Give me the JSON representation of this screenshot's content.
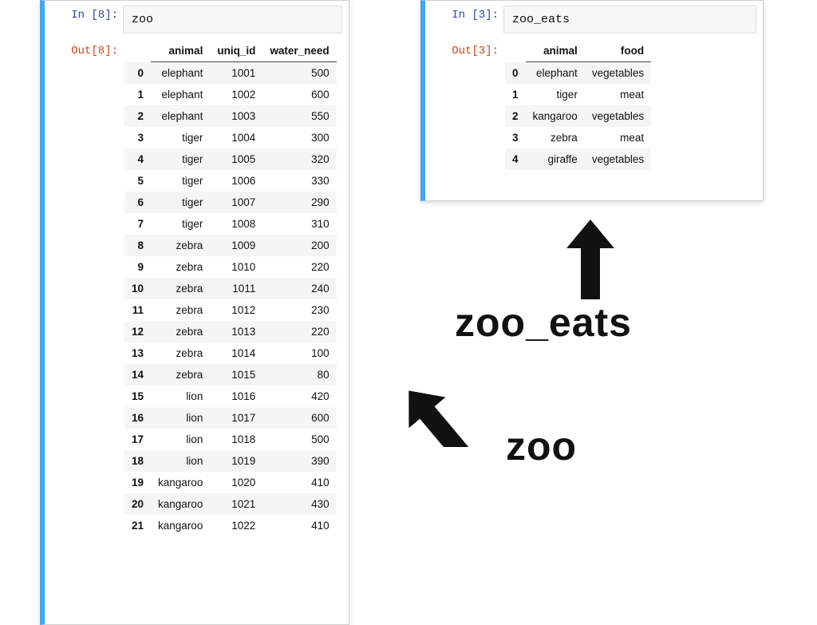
{
  "cells": {
    "left": {
      "in_prompt": "In [8]:",
      "out_prompt": "Out[8]:",
      "code": "zoo",
      "columns": [
        "animal",
        "uniq_id",
        "water_need"
      ],
      "rows": [
        {
          "idx": "0",
          "animal": "elephant",
          "uniq_id": "1001",
          "water_need": "500"
        },
        {
          "idx": "1",
          "animal": "elephant",
          "uniq_id": "1002",
          "water_need": "600"
        },
        {
          "idx": "2",
          "animal": "elephant",
          "uniq_id": "1003",
          "water_need": "550"
        },
        {
          "idx": "3",
          "animal": "tiger",
          "uniq_id": "1004",
          "water_need": "300"
        },
        {
          "idx": "4",
          "animal": "tiger",
          "uniq_id": "1005",
          "water_need": "320"
        },
        {
          "idx": "5",
          "animal": "tiger",
          "uniq_id": "1006",
          "water_need": "330"
        },
        {
          "idx": "6",
          "animal": "tiger",
          "uniq_id": "1007",
          "water_need": "290"
        },
        {
          "idx": "7",
          "animal": "tiger",
          "uniq_id": "1008",
          "water_need": "310"
        },
        {
          "idx": "8",
          "animal": "zebra",
          "uniq_id": "1009",
          "water_need": "200"
        },
        {
          "idx": "9",
          "animal": "zebra",
          "uniq_id": "1010",
          "water_need": "220"
        },
        {
          "idx": "10",
          "animal": "zebra",
          "uniq_id": "1011",
          "water_need": "240"
        },
        {
          "idx": "11",
          "animal": "zebra",
          "uniq_id": "1012",
          "water_need": "230"
        },
        {
          "idx": "12",
          "animal": "zebra",
          "uniq_id": "1013",
          "water_need": "220"
        },
        {
          "idx": "13",
          "animal": "zebra",
          "uniq_id": "1014",
          "water_need": "100"
        },
        {
          "idx": "14",
          "animal": "zebra",
          "uniq_id": "1015",
          "water_need": "80"
        },
        {
          "idx": "15",
          "animal": "lion",
          "uniq_id": "1016",
          "water_need": "420"
        },
        {
          "idx": "16",
          "animal": "lion",
          "uniq_id": "1017",
          "water_need": "600"
        },
        {
          "idx": "17",
          "animal": "lion",
          "uniq_id": "1018",
          "water_need": "500"
        },
        {
          "idx": "18",
          "animal": "lion",
          "uniq_id": "1019",
          "water_need": "390"
        },
        {
          "idx": "19",
          "animal": "kangaroo",
          "uniq_id": "1020",
          "water_need": "410"
        },
        {
          "idx": "20",
          "animal": "kangaroo",
          "uniq_id": "1021",
          "water_need": "430"
        },
        {
          "idx": "21",
          "animal": "kangaroo",
          "uniq_id": "1022",
          "water_need": "410"
        }
      ]
    },
    "right": {
      "in_prompt": "In [3]:",
      "out_prompt": "Out[3]:",
      "code": "zoo_eats",
      "columns": [
        "animal",
        "food"
      ],
      "rows": [
        {
          "idx": "0",
          "animal": "elephant",
          "food": "vegetables"
        },
        {
          "idx": "1",
          "animal": "tiger",
          "food": "meat"
        },
        {
          "idx": "2",
          "animal": "kangaroo",
          "food": "vegetables"
        },
        {
          "idx": "3",
          "animal": "zebra",
          "food": "meat"
        },
        {
          "idx": "4",
          "animal": "giraffe",
          "food": "vegetables"
        }
      ]
    }
  },
  "annotations": {
    "zoo_eats": "zoo_eats",
    "zoo": "zoo"
  }
}
